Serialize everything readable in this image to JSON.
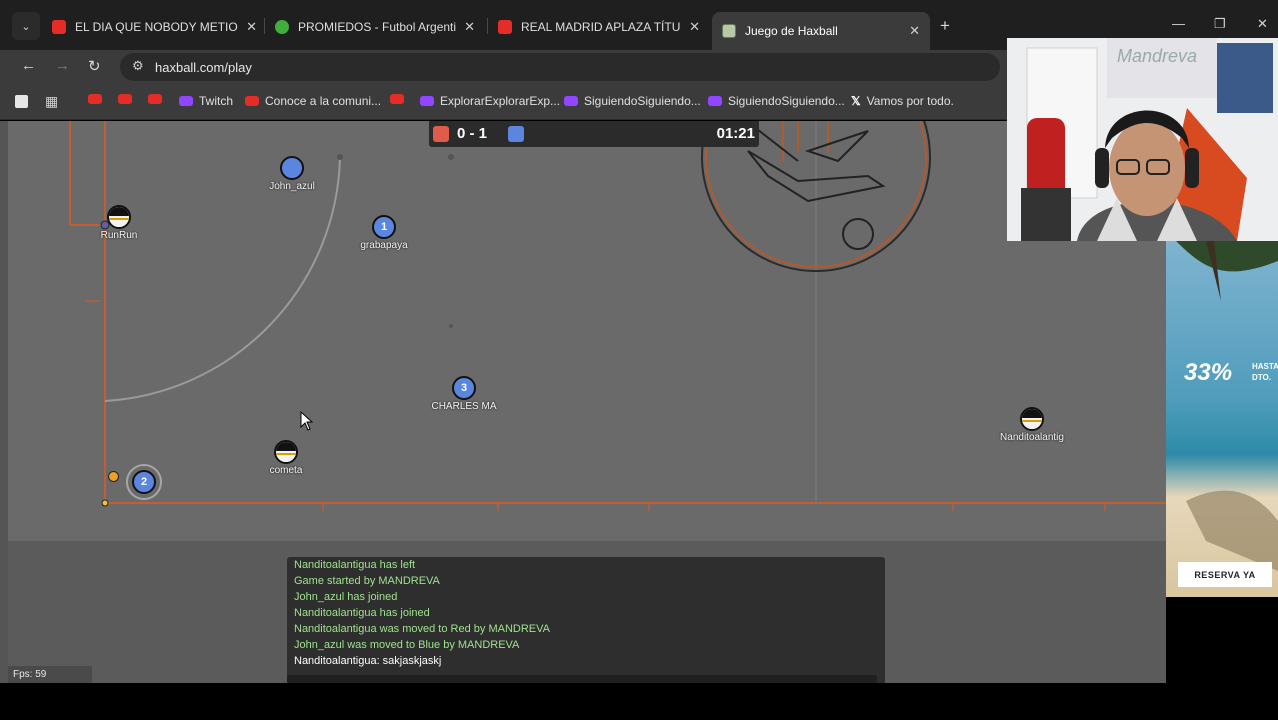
{
  "browser": {
    "tabs": [
      {
        "label": "EL DIA QUE NOBODY METIO",
        "favicon": "youtube",
        "active": false
      },
      {
        "label": "PROMIEDOS - Futbol Argentino",
        "favicon": "promiedos",
        "active": false
      },
      {
        "label": "REAL MADRID APLAZA TÍTULO",
        "favicon": "youtube",
        "active": false
      },
      {
        "label": "Juego de Haxball",
        "favicon": "haxball",
        "active": true
      }
    ],
    "close_glyph": "✕",
    "new_tab_glyph": "+",
    "url": "haxball.com/play",
    "bookmarks": [
      {
        "label": "",
        "favicon": "youtube"
      },
      {
        "label": "",
        "favicon": "youtube"
      },
      {
        "label": "",
        "favicon": "youtube"
      },
      {
        "label": "Twitch",
        "favicon": "twitch"
      },
      {
        "label": "Conoce a la comuni...",
        "favicon": "youtube"
      },
      {
        "label": "",
        "favicon": "youtube"
      },
      {
        "label": "ExplorarExplorarExp...",
        "favicon": "twitch"
      },
      {
        "label": "SiguiendoSiguiendo...",
        "favicon": "twitch"
      },
      {
        "label": "SiguiendoSiguiendo...",
        "favicon": "twitch"
      },
      {
        "label": "Vamos por todo.",
        "favicon": "x"
      }
    ]
  },
  "game": {
    "score": "0 - 1",
    "timer": "01:21",
    "team_colors": {
      "red": "#e05c4a",
      "blue": "#5a86e0"
    },
    "players": [
      {
        "name": "John_azul",
        "team": "blue",
        "number": ""
      },
      {
        "name": "grabapaya",
        "team": "blue",
        "number": "1"
      },
      {
        "name": "CHARLES MA",
        "team": "blue",
        "number": "3"
      },
      {
        "name": "",
        "team": "blue",
        "number": "2"
      },
      {
        "name": "RunRun",
        "team": "red",
        "number": ""
      },
      {
        "name": "cometa",
        "team": "red",
        "number": ""
      },
      {
        "name": "Nanditoalantig",
        "team": "red",
        "number": ""
      }
    ],
    "chat": [
      {
        "text": "Nanditoalantigua has left",
        "type": "sys"
      },
      {
        "text": "Game started by MANDREVA",
        "type": "sys"
      },
      {
        "text": "John_azul has joined",
        "type": "sys"
      },
      {
        "text": "Nanditoalantigua has joined",
        "type": "sys"
      },
      {
        "text": "Nanditoalantigua was moved to Red by MANDREVA",
        "type": "sys"
      },
      {
        "text": "John_azul was moved to Blue by MANDREVA",
        "type": "sys"
      },
      {
        "text": "Nanditoalantigua: sakjaskjaskj",
        "type": "msg"
      }
    ],
    "fps": "Fps: 59"
  },
  "overlay": {
    "webcam_label": "Mandreva",
    "ad_percent": "33%",
    "ad_small": "HASTA DTO.",
    "ad_button": "RESERVA YA"
  }
}
